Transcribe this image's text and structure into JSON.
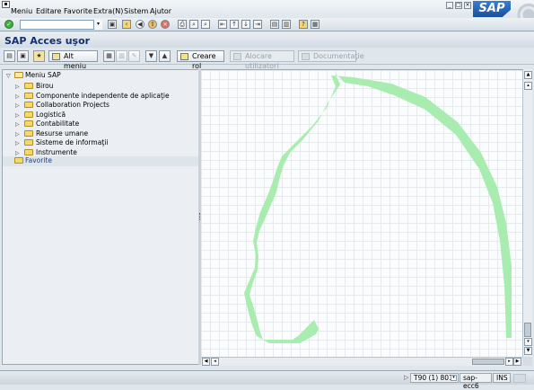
{
  "menubar": {
    "items": [
      {
        "label": "Meniu"
      },
      {
        "label": "Editare"
      },
      {
        "label": "Favorite"
      },
      {
        "label": "Extra(N)"
      },
      {
        "label": "Sistem"
      },
      {
        "label": "Ajutor"
      }
    ],
    "logo": "SAP"
  },
  "stdbar": {
    "command_value": ""
  },
  "title": "SAP Acces uşor",
  "appbar": {
    "other_menu": "Alt meniu",
    "create_role": "Creare rol",
    "assign_users": "Alocare utilizatori",
    "documentation": "Documentaţie"
  },
  "tree": {
    "root": "Meniu SAP",
    "children": [
      {
        "label": "Birou"
      },
      {
        "label": "Componente independente de aplicaţie"
      },
      {
        "label": "Collaboration Projects"
      },
      {
        "label": "Logistică"
      },
      {
        "label": "Contabilitate"
      },
      {
        "label": "Resurse umane"
      },
      {
        "label": "Sisteme de informaţii"
      },
      {
        "label": "Instrumente"
      }
    ],
    "favorites": "Favorite"
  },
  "canvas": {
    "stroke_color": "#a8ecaf",
    "grid_color": "#e6eaed"
  },
  "status": {
    "system": "T90 (1) 801",
    "server": "sap-ecc6",
    "mode": "INS"
  }
}
